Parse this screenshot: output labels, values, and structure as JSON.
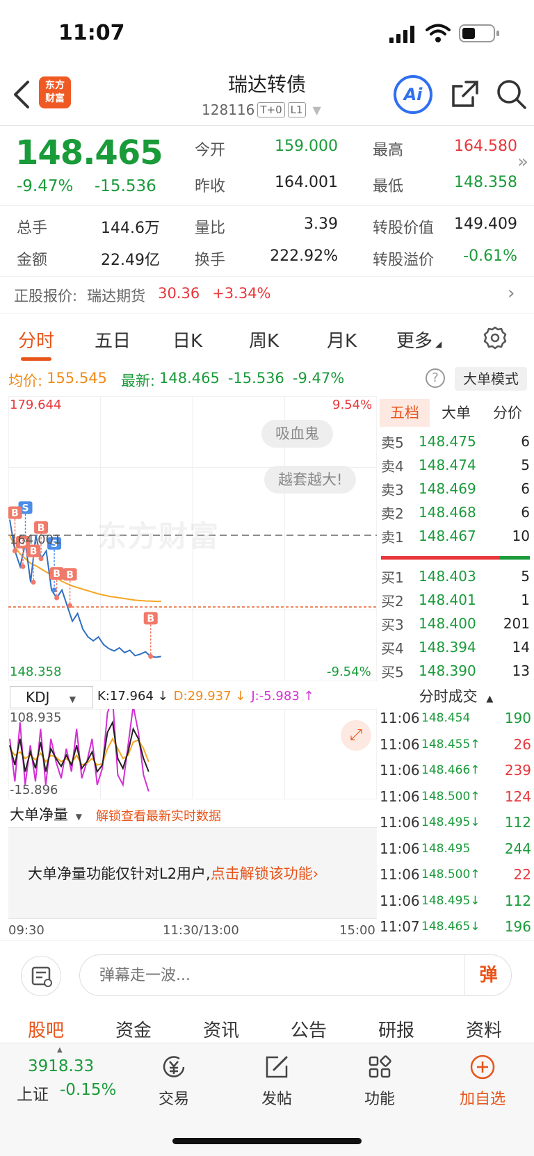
{
  "status": {
    "time": "11:07"
  },
  "header": {
    "logo_line1": "东方",
    "logo_line2": "财富",
    "name": "瑞达转债",
    "code": "128116",
    "tag1": "T+0",
    "tag2": "L1",
    "ai_label": "Ai"
  },
  "quote": {
    "price": "148.465",
    "pct": "-9.47%",
    "change": "-15.536",
    "open_label": "今开",
    "open": "159.000",
    "high_label": "最高",
    "high": "164.580",
    "prev_label": "昨收",
    "prev": "164.001",
    "low_label": "最低",
    "low": "148.358",
    "vol_label": "总手",
    "vol": "144.6万",
    "ratio_label": "量比",
    "ratio": "3.39",
    "conv_label": "转股价值",
    "conv": "149.409",
    "amt_label": "金额",
    "amt": "22.49亿",
    "turn_label": "换手",
    "turn": "222.92%",
    "prem_label": "转股溢价",
    "prem": "-0.61%"
  },
  "underlying": {
    "label": "正股报价:",
    "name": "瑞达期货",
    "price": "30.36",
    "pct": "+3.34%"
  },
  "tabs": [
    "分时",
    "五日",
    "日K",
    "周K",
    "月K",
    "更多"
  ],
  "avg": {
    "avg_label": "均价:",
    "avg": "155.545",
    "last_label": "最新:",
    "last": "148.465",
    "chg": "-15.536",
    "pct": "-9.47%",
    "mode_btn": "大单模式",
    "help": "?"
  },
  "chart_data": {
    "type": "line",
    "y_max": "179.644",
    "y_max_pct": "9.54%",
    "y_min": "148.358",
    "y_min_pct": "-9.54%",
    "prev_close": "164.001",
    "ylim": [
      148.358,
      179.644
    ],
    "x_labels": [
      "09:30",
      "11:30/13:00",
      "15:00"
    ],
    "price_series": [
      166,
      162,
      160,
      163,
      158,
      164,
      161,
      162,
      157,
      156,
      157,
      155,
      153,
      154,
      152,
      151,
      150.5,
      151,
      150,
      149.5,
      149.2,
      149.6,
      149,
      149.3,
      148.6,
      148.8,
      149.1,
      148.5,
      148.4,
      148.5
    ],
    "avg_series": [
      164,
      162.5,
      161.6,
      161,
      160.4,
      160.1,
      159.7,
      159.3,
      158.9,
      158.5,
      158.1,
      157.8,
      157.5,
      157.3,
      157.1,
      156.9,
      156.7,
      156.5,
      156.35,
      156.2,
      156.1,
      156,
      155.9,
      155.8,
      155.7,
      155.65,
      155.6,
      155.58,
      155.55,
      155.545
    ],
    "markers": [
      {
        "label": "S",
        "idx": 3
      },
      {
        "label": "B",
        "idx": 4
      },
      {
        "label": "B",
        "idx": 1
      },
      {
        "label": "B",
        "idx": 2
      },
      {
        "label": "B",
        "idx": 6
      },
      {
        "label": "S",
        "idx": 8
      },
      {
        "label": "B",
        "idx": 9
      },
      {
        "label": "B",
        "idx": 11
      },
      {
        "label": "B",
        "idx": 27
      }
    ]
  },
  "danmu": [
    "吸血鬼",
    "越套越大!"
  ],
  "watermark": "东方财富",
  "orderbook": {
    "tabs": [
      "五档",
      "大单",
      "分价"
    ],
    "asks": [
      {
        "label": "卖5",
        "price": "148.475",
        "vol": "6"
      },
      {
        "label": "卖4",
        "price": "148.474",
        "vol": "5"
      },
      {
        "label": "卖3",
        "price": "148.469",
        "vol": "6"
      },
      {
        "label": "卖2",
        "price": "148.468",
        "vol": "6"
      },
      {
        "label": "卖1",
        "price": "148.467",
        "vol": "10"
      }
    ],
    "bids": [
      {
        "label": "买1",
        "price": "148.403",
        "vol": "5"
      },
      {
        "label": "买2",
        "price": "148.401",
        "vol": "1"
      },
      {
        "label": "买3",
        "price": "148.400",
        "vol": "201"
      },
      {
        "label": "买4",
        "price": "148.394",
        "vol": "14"
      },
      {
        "label": "买5",
        "price": "148.390",
        "vol": "13"
      }
    ]
  },
  "kdj": {
    "select": "KDJ",
    "k": "K:17.964 ↓",
    "d": "D:29.937 ↓",
    "j": "J:-5.983 ↑",
    "top": "108.935",
    "bottom": "-15.896",
    "k_series": [
      60,
      30,
      70,
      20,
      50,
      25,
      65,
      20,
      55,
      40,
      28,
      45,
      30,
      60,
      25,
      35,
      50,
      20,
      30,
      80,
      95,
      40,
      25,
      50,
      85,
      70,
      40,
      20
    ],
    "d_series": [
      55,
      45,
      50,
      40,
      45,
      38,
      48,
      35,
      45,
      42,
      35,
      40,
      33,
      45,
      30,
      33,
      40,
      30,
      32,
      55,
      70,
      55,
      40,
      45,
      65,
      68,
      55,
      35
    ],
    "j_series": [
      70,
      5,
      95,
      0,
      60,
      5,
      85,
      0,
      70,
      35,
      10,
      55,
      20,
      85,
      10,
      35,
      70,
      0,
      25,
      110,
      130,
      15,
      0,
      60,
      120,
      80,
      15,
      -10
    ]
  },
  "net": {
    "select": "大单净量",
    "unlock": "解锁查看最新实时数据",
    "msg": "大单净量功能仅针对L2用户,",
    "link": "点击解锁该功能›"
  },
  "ticks": {
    "title": "分时成交",
    "rows": [
      {
        "time": "11:06",
        "price": "148.454",
        "vol": "190",
        "pc": "green",
        "vc": "green"
      },
      {
        "time": "11:06",
        "price": "148.455↑",
        "vol": "26",
        "pc": "green",
        "vc": "red"
      },
      {
        "time": "11:06",
        "price": "148.466↑",
        "vol": "239",
        "pc": "green",
        "vc": "red"
      },
      {
        "time": "11:06",
        "price": "148.500↑",
        "vol": "124",
        "pc": "green",
        "vc": "red"
      },
      {
        "time": "11:06",
        "price": "148.495↓",
        "vol": "112",
        "pc": "green",
        "vc": "green"
      },
      {
        "time": "11:06",
        "price": "148.495",
        "vol": "244",
        "pc": "green",
        "vc": "green"
      },
      {
        "time": "11:06",
        "price": "148.500↑",
        "vol": "22",
        "pc": "green",
        "vc": "red"
      },
      {
        "time": "11:06",
        "price": "148.495↓",
        "vol": "112",
        "pc": "green",
        "vc": "green"
      },
      {
        "time": "11:07",
        "price": "148.465↓",
        "vol": "196",
        "pc": "green",
        "vc": "green"
      }
    ]
  },
  "comment": {
    "placeholder": "弹幕走一波...",
    "send": "弹"
  },
  "content_tabs": [
    "股吧",
    "资金",
    "资讯",
    "公告",
    "研报",
    "资料"
  ],
  "bottom": {
    "index_val": "3918.33",
    "index_name": "上证",
    "index_pct": "-0.15%",
    "items": [
      "交易",
      "发帖",
      "功能",
      "加自选"
    ]
  },
  "colors": {
    "up": "#e8363b",
    "down": "#1a9b3a",
    "accent": "#e8541a",
    "avg": "#f5a623",
    "price_line": "#2f6fc0"
  }
}
